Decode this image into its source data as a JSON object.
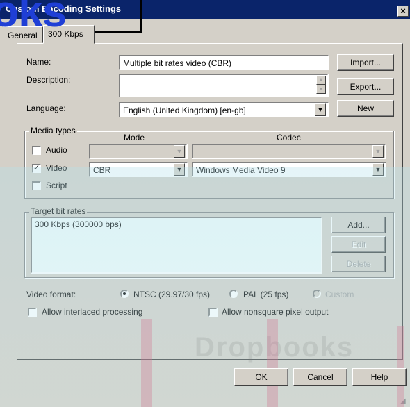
{
  "window": {
    "title": "Custom Encoding Settings",
    "close_label": "×"
  },
  "overlay": {
    "logo_text": "oks"
  },
  "tabs": [
    {
      "label": "General"
    },
    {
      "label": "300 Kbps"
    }
  ],
  "general": {
    "name_label": "Name:",
    "name_value": "Multiple bit rates video (CBR)",
    "description_label": "Description:",
    "description_value": "",
    "language_label": "Language:",
    "language_value": "English (United Kingdom) [en-gb]",
    "import_button": "Import...",
    "export_button": "Export...",
    "new_button": "New"
  },
  "media_types": {
    "group_title": "Media types",
    "mode_header": "Mode",
    "codec_header": "Codec",
    "audio_label": "Audio",
    "video_label": "Video",
    "script_label": "Script",
    "audio_checked": false,
    "video_checked": true,
    "script_checked": false,
    "audio_mode": "",
    "audio_codec": "",
    "video_mode": "CBR",
    "video_codec": "Windows Media Video 9"
  },
  "bit_rates": {
    "group_title": "Target bit rates",
    "items": [
      "300 Kbps (300000 bps)"
    ],
    "add_button": "Add...",
    "edit_button": "Edit",
    "delete_button": "Delete"
  },
  "video_format": {
    "label": "Video format:",
    "ntsc_label": "NTSC (29.97/30 fps)",
    "pal_label": "PAL (25 fps)",
    "custom_label": "Custom",
    "selected": "NTSC",
    "interlaced_label": "Allow interlaced processing",
    "nonsquare_label": "Allow nonsquare pixel output",
    "interlaced_checked": false,
    "nonsquare_checked": false
  },
  "footer": {
    "ok_button": "OK",
    "cancel_button": "Cancel",
    "help_button": "Help"
  },
  "watermark": {
    "text": "Dropbooks"
  },
  "colors": {
    "titlebar": "#0a246a",
    "face": "#d4d0c8",
    "logo": "#1f3fd6"
  }
}
